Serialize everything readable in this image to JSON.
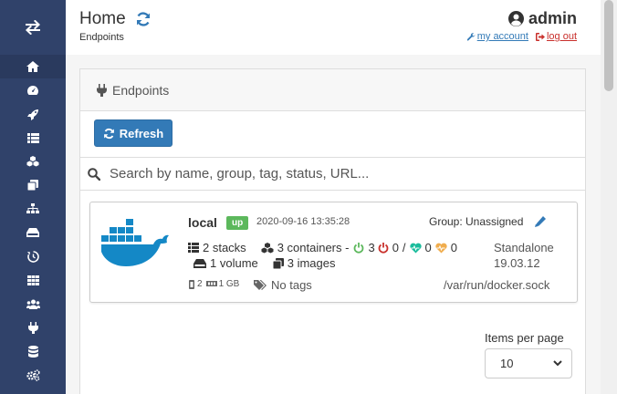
{
  "header": {
    "title": "Home",
    "breadcrumb": "Endpoints",
    "username": "admin",
    "my_account": "my account",
    "log_out": "log out"
  },
  "sidebar": {
    "items": [
      "home-icon",
      "dashboard-icon",
      "rocket-icon",
      "list-icon",
      "cubes-icon",
      "clone-icon",
      "sitemap-icon",
      "hdd-icon",
      "history-icon",
      "th-icon",
      "users-icon",
      "plug-icon",
      "database-icon",
      "cogs-icon"
    ]
  },
  "panel": {
    "heading": "Endpoints",
    "refresh_label": "Refresh",
    "search_placeholder": "Search by name, group, tag, status, URL..."
  },
  "endpoint": {
    "name": "local",
    "status": "up",
    "date": "2020-09-16 13:35:28",
    "group": "Group: Unassigned",
    "stacks": "2 stacks",
    "containers": "3 containers -",
    "running": "3",
    "stopped": "0",
    "healthy": "0",
    "unhealthy": "0",
    "volumes": "1 volume",
    "images": "3 images",
    "cpu": "2",
    "memory": "1 GB",
    "tags": "No tags",
    "type": "Standalone",
    "version": "19.03.12",
    "url": "/var/run/docker.sock"
  },
  "pagination": {
    "label": "Items per page",
    "value": "10"
  },
  "colors": {
    "sidebar": "#30426a",
    "primary": "#337ab7",
    "success": "#5cb85c",
    "danger": "#c9302c",
    "healthy": "#1abc9c",
    "warning": "#f0ad4e",
    "docker": "#1488c6"
  }
}
